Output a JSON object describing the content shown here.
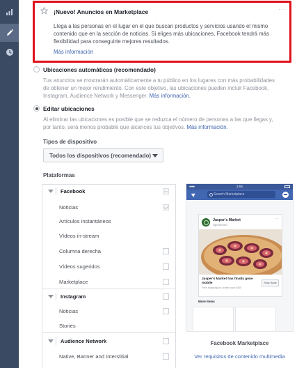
{
  "sidebar": {
    "items": [
      {
        "icon": "bar-chart-icon",
        "active": false
      },
      {
        "icon": "pencil-icon",
        "active": true
      },
      {
        "icon": "clock-icon",
        "active": false
      }
    ]
  },
  "notice": {
    "title": "¡Nuevo! Anuncios en Marketplace",
    "dots": "···",
    "body": "Llega a las personas en el lugar en el que buscan productos y servicios usando el mismo contenido que en la sección de noticias. Si eliges más ubicaciones, Facebook tendrá más flexibilidad para conseguirte mejores resultados.",
    "link": "Más información"
  },
  "placements": {
    "automatic": {
      "title": "Ubicaciones automáticas (recomendado)",
      "desc": "Tus anuncios se mostrarán automáticamente a tu público en los lugares con más probabilidades de obtener un mejor rendimiento. Con este objetivo, las ubicaciones pueden incluir Facebook, Instagram, Audience Network y Messenger.",
      "link": "Más información."
    },
    "edit": {
      "title": "Editar ubicaciones",
      "desc": "Al eliminar las ubicaciones es posible que se reduzca el número de personas a las que llegas y, por tanto, será menos probable que alcances tus objetivos.",
      "link": "Más información."
    },
    "selected": "edit"
  },
  "device": {
    "label": "Tipos de dispositivo",
    "value": "Todos los dispositivos (recomendado)"
  },
  "platforms": {
    "label": "Plataformas",
    "facebook": {
      "name": "Facebook",
      "items": [
        "Noticias",
        "Artículos instantáneos",
        "Vídeos in-stream",
        "Columna derecha",
        "Vídeos sugeridos",
        "Marketplace"
      ]
    },
    "instagram": {
      "name": "Instagram",
      "items": [
        "Noticias",
        "Stories"
      ]
    },
    "audience_network": {
      "name": "Audience Network",
      "items": [
        "Native, Banner and Interstitial"
      ]
    }
  },
  "preview": {
    "status_time": "2:04",
    "search_placeholder": "Search Marketplace",
    "advertiser": "Jasper's Market",
    "sponsored": "Sponsored",
    "headline": "Jasper's Market has finally gone mobile",
    "subtext": "Free shipping on orders over $50!",
    "cta": "Shop Now",
    "more_items": "More Items",
    "caption": "Facebook Marketplace",
    "requirements_link": "Ver requisitos de contenido multimedia"
  },
  "colors": {
    "rail": "#3b4a63",
    "highlight_border": "#e0101a",
    "link": "#4267b2",
    "fb_blue": "#4267b2"
  }
}
